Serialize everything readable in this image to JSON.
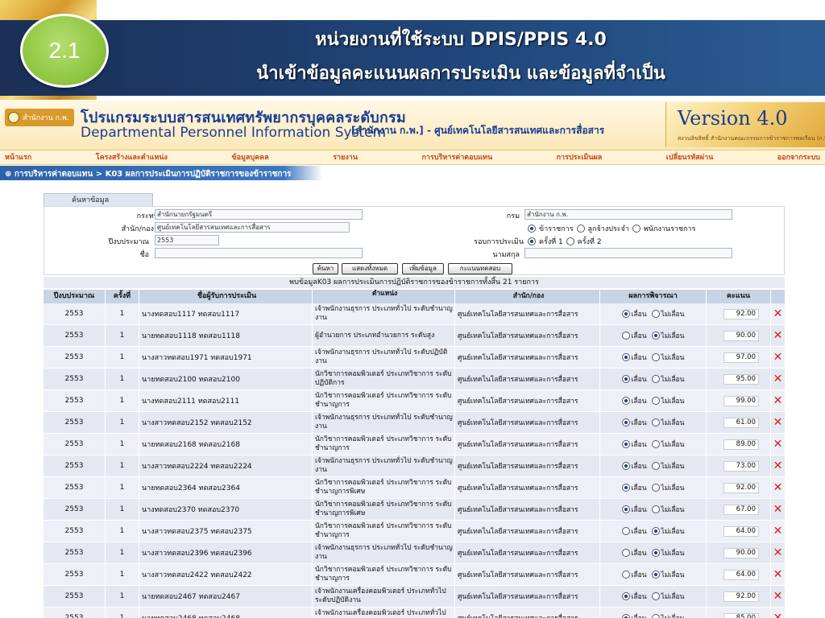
{
  "slide": {
    "number": "2.1",
    "title_line_1": "หน่วยงานที่ใช้ระบบ DPIS/PPIS 4.0",
    "title_line_2": "นำเข้าข้อมูลคะแนนผลการประเมิน และข้อมูลที่จำเป็น"
  },
  "app": {
    "office_logo": "สำนักงาน ก.พ.",
    "system_title_th": "โปรแกรมระบบสารสนเทศทรัพยากรบุคคลระดับกรม",
    "system_title_en": "Departmental Personnel Information System",
    "current_unit": "[สำนักงาน ก.พ.] - ศูนย์เทคโนโลยีสารสนเทศและการสื่อสาร",
    "version": "Version 4.0",
    "version_note": "สงวนลิขสิทธิ์ สำนักงานคณะกรรมการข้าราชการพลเรือน (ก.พ.)",
    "menu": [
      "หน้าแรก",
      "โครงสร้างและตำแหน่ง",
      "ข้อมูลบุคคล",
      "รายงาน",
      "การบริหารค่าตอบแทน",
      "การประเมินผล",
      "เปลี่ยนรหัสผ่าน",
      "ออกจากระบบ"
    ],
    "breadcrumb": "⊕ การบริหารค่าตอบแทน > K03 ผลการประเมินการปฏิบัติราชการของข้าราชการ"
  },
  "search": {
    "tab_label": "ค้นหาข้อมูล",
    "ministry_label": "กระทรวง",
    "ministry_value": "สำนักนายกรัฐมนตรี",
    "department_label": "กรม",
    "department_value": "สำนักงาน ก.พ.",
    "division_label": "สำนัก/กอง",
    "division_value": "ศูนย์เทคโนโลยีสารสนเทศและการสื่อสาร",
    "type_options": [
      "ข้าราชการ",
      "ลูกจ้างประจำ",
      "พนักงานราชการ"
    ],
    "budget_year_label": "ปีงบประมาณ",
    "budget_year_value": "2553",
    "round_label": "รอบการประเมิน",
    "round_options": [
      "ครั้งที่ 1",
      "ครั้งที่ 2"
    ],
    "first_name_label": "ชื่อ",
    "last_name_label": "นามสกุล",
    "buttons": [
      "ค้นหา",
      "แสดงทั้งหมด",
      "เพิ่มข้อมูล",
      "กะแนนทดสอบ"
    ]
  },
  "result_summary": "พบข้อมูลK03 ผลการประเมินการปฏิบัติราชการของข้าราชการทั้งสิ้น 21 รายการ",
  "table": {
    "headers": [
      "ปีงบประมาณ",
      "ครั้งที่",
      "ชื่อผู้รับการประเมิน",
      "ตำแหน่ง",
      "สำนัก/กอง",
      "ผลการพิจารณา",
      "คะแนน"
    ],
    "result_options": [
      "เลื่อน",
      "ไม่เลื่อน"
    ],
    "rows": [
      {
        "year": "2553",
        "round": "1",
        "name": "นางทดสอบ1117 ทดสอบ1117",
        "position": "เจ้าพนักงานธุรการ ประเภททั่วไป ระดับชำนาญงาน",
        "unit": "ศูนย์เทคโนโลยีสารสนเทศและการสื่อสาร",
        "promote": true,
        "score": "92.00"
      },
      {
        "year": "2553",
        "round": "1",
        "name": "นายทดสอบ1118 ทดสอบ1118",
        "position": "ผู้อำนวยการ ประเภทอำนวยการ ระดับสูง",
        "unit": "ศูนย์เทคโนโลยีสารสนเทศและการสื่อสาร",
        "promote": false,
        "score": "90.00"
      },
      {
        "year": "2553",
        "round": "1",
        "name": "นางสาวทดสอบ1971 ทดสอบ1971",
        "position": "เจ้าพนักงานธุรการ ประเภททั่วไป ระดับปฏิบัติงาน",
        "unit": "ศูนย์เทคโนโลยีสารสนเทศและการสื่อสาร",
        "promote": true,
        "score": "97.00"
      },
      {
        "year": "2553",
        "round": "1",
        "name": "นายทดสอบ2100 ทดสอบ2100",
        "position": "นักวิชาการคอมพิวเตอร์ ประเภทวิชาการ ระดับปฏิบัติการ",
        "unit": "ศูนย์เทคโนโลยีสารสนเทศและการสื่อสาร",
        "promote": true,
        "score": "95.00"
      },
      {
        "year": "2553",
        "round": "1",
        "name": "นางทดสอบ2111 ทดสอบ2111",
        "position": "นักวิชาการคอมพิวเตอร์ ประเภทวิชาการ ระดับชำนาญการ",
        "unit": "ศูนย์เทคโนโลยีสารสนเทศและการสื่อสาร",
        "promote": true,
        "score": "99.00"
      },
      {
        "year": "2553",
        "round": "1",
        "name": "นางสาวทดสอบ2152 ทดสอบ2152",
        "position": "เจ้าพนักงานธุรการ ประเภททั่วไป ระดับชำนาญงาน",
        "unit": "ศูนย์เทคโนโลยีสารสนเทศและการสื่อสาร",
        "promote": true,
        "score": "61.00"
      },
      {
        "year": "2553",
        "round": "1",
        "name": "นายทดสอบ2168 ทดสอบ2168",
        "position": "นักวิชาการคอมพิวเตอร์ ประเภทวิชาการ ระดับชำนาญการ",
        "unit": "ศูนย์เทคโนโลยีสารสนเทศและการสื่อสาร",
        "promote": true,
        "score": "89.00"
      },
      {
        "year": "2553",
        "round": "1",
        "name": "นางสาวทดสอบ2224 ทดสอบ2224",
        "position": "เจ้าพนักงานธุรการ ประเภททั่วไป ระดับชำนาญงาน",
        "unit": "ศูนย์เทคโนโลยีสารสนเทศและการสื่อสาร",
        "promote": true,
        "score": "73.00"
      },
      {
        "year": "2553",
        "round": "1",
        "name": "นายทดสอบ2364 ทดสอบ2364",
        "position": "นักวิชาการคอมพิวเตอร์ ประเภทวิชาการ ระดับชำนาญการพิเศษ",
        "unit": "ศูนย์เทคโนโลยีสารสนเทศและการสื่อสาร",
        "promote": true,
        "score": "92.00"
      },
      {
        "year": "2553",
        "round": "1",
        "name": "นางทดสอบ2370 ทดสอบ2370",
        "position": "นักวิชาการคอมพิวเตอร์ ประเภทวิชาการ ระดับชำนาญการพิเศษ",
        "unit": "ศูนย์เทคโนโลยีสารสนเทศและการสื่อสาร",
        "promote": true,
        "score": "67.00"
      },
      {
        "year": "2553",
        "round": "1",
        "name": "นางสาวทดสอบ2375 ทดสอบ2375",
        "position": "นักวิชาการคอมพิวเตอร์ ประเภทวิชาการ ระดับชำนาญการ",
        "unit": "ศูนย์เทคโนโลยีสารสนเทศและการสื่อสาร",
        "promote": false,
        "score": "64.00"
      },
      {
        "year": "2553",
        "round": "1",
        "name": "นางสาวทดสอบ2396 ทดสอบ2396",
        "position": "เจ้าพนักงานธุรการ ประเภททั่วไป ระดับชำนาญงาน",
        "unit": "ศูนย์เทคโนโลยีสารสนเทศและการสื่อสาร",
        "promote": false,
        "score": "90.00"
      },
      {
        "year": "2553",
        "round": "1",
        "name": "นางสาวทดสอบ2422 ทดสอบ2422",
        "position": "นักวิชาการคอมพิวเตอร์ ประเภทวิชาการ ระดับชำนาญการ",
        "unit": "ศูนย์เทคโนโลยีสารสนเทศและการสื่อสาร",
        "promote": false,
        "score": "64.00"
      },
      {
        "year": "2553",
        "round": "1",
        "name": "นายทดสอบ2467 ทดสอบ2467",
        "position": "เจ้าพนักงานเครื่องคอมพิวเตอร์ ประเภททั่วไป ระดับปฏิบัติงาน",
        "unit": "ศูนย์เทคโนโลยีสารสนเทศและการสื่อสาร",
        "promote": true,
        "score": "92.00"
      },
      {
        "year": "2553",
        "round": "1",
        "name": "นายทดสอบ2468 ทดสอบ2468",
        "position": "เจ้าพนักงานเครื่องคอมพิวเตอร์ ประเภททั่วไป ระดับปฏิบัติงาน",
        "unit": "ศูนย์เทคโนโลยีสารสนเทศและการสื่อสาร",
        "promote": true,
        "score": "85.00"
      }
    ]
  }
}
